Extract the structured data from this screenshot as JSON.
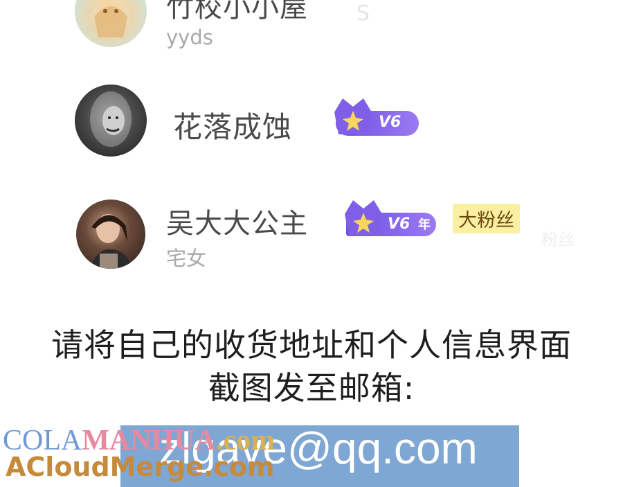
{
  "users": [
    {
      "name": "竹校小小屋",
      "bio": "yyds",
      "avatar": "anime-girl-avatar"
    },
    {
      "name": "花落成蚀",
      "vip_level": "V6",
      "vip_color": "#7a5ae6",
      "avatar": "bw-portrait-avatar"
    },
    {
      "name": "吴大大公主",
      "bio": "宅女",
      "vip_level": "V6",
      "vip_suffix": "年",
      "fan_badge": "大粉丝",
      "faded_text": "粉丝",
      "avatar": "photo-portrait-avatar"
    }
  ],
  "notice_line1": "请将自己的收货地址和个人信息界面",
  "notice_line2": "截图发至邮箱:",
  "email": "zlgave@qq.com",
  "email_bg": "#7fa7d4",
  "watermark_line1": [
    "COLA",
    "MANHUA",
    ".com"
  ],
  "watermark_line2": "ACloudMerge.com"
}
